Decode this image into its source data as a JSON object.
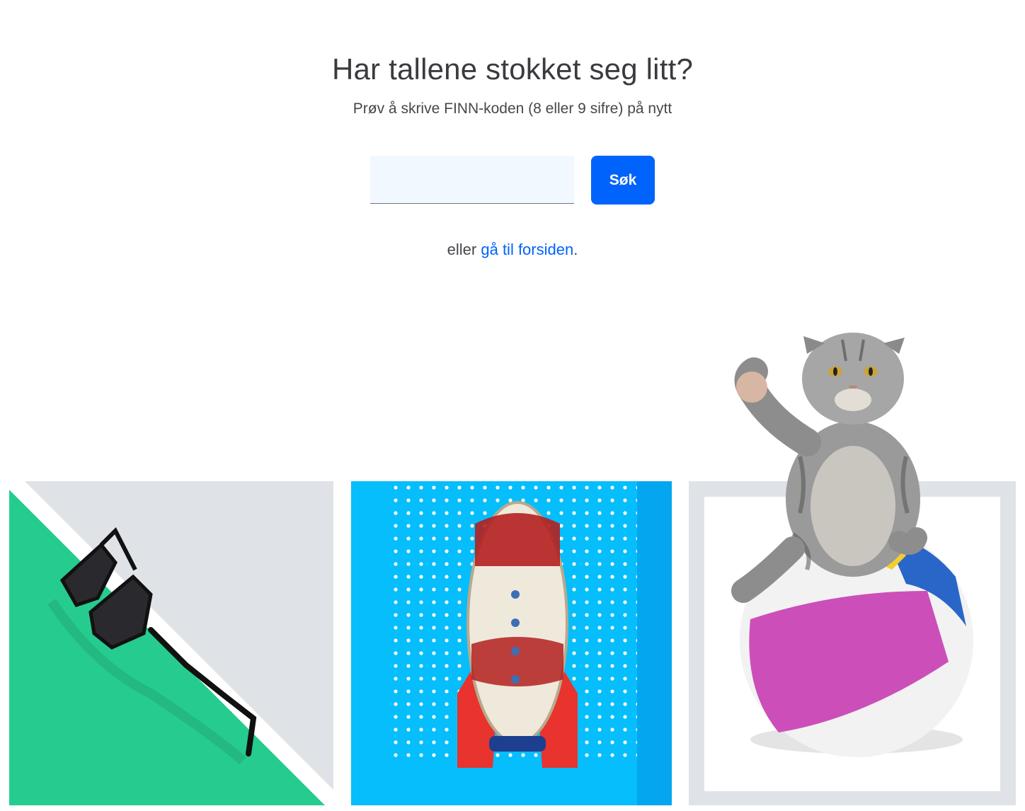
{
  "heading": "Har tallene stokket seg litt?",
  "subheading": "Prøv å skrive FINN-koden (8 eller 9 sifre) på nytt",
  "search": {
    "value": "",
    "placeholder": "",
    "button_label": "Søk"
  },
  "alternative": {
    "prefix": "eller",
    "link_text": "gå til forsiden",
    "suffix": "."
  },
  "images": [
    {
      "icon": "sunglasses-image"
    },
    {
      "icon": "rocket-toy-image"
    },
    {
      "icon": "cat-on-beach-ball-image"
    }
  ],
  "colors": {
    "accent": "#0063fb",
    "input_bg": "#f1f8ff",
    "tile_grey": "#dfe3e8",
    "tile_green": "#26cc8f",
    "tile_blue": "#06befb"
  }
}
